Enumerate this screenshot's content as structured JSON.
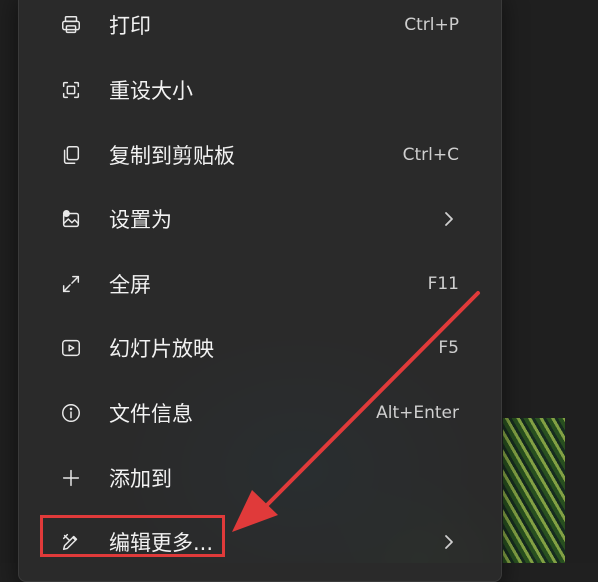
{
  "menu": {
    "items": [
      {
        "icon": "printer-icon",
        "label": "打印",
        "shortcut": "Ctrl+P",
        "submenu": false
      },
      {
        "icon": "resize-icon",
        "label": "重设大小",
        "shortcut": "",
        "submenu": false
      },
      {
        "icon": "copy-icon",
        "label": "复制到剪贴板",
        "shortcut": "Ctrl+C",
        "submenu": false
      },
      {
        "icon": "set-as-icon",
        "label": "设置为",
        "shortcut": "",
        "submenu": true
      },
      {
        "icon": "fullscreen-icon",
        "label": "全屏",
        "shortcut": "F11",
        "submenu": false
      },
      {
        "icon": "slideshow-icon",
        "label": "幻灯片放映",
        "shortcut": "F5",
        "submenu": false
      },
      {
        "icon": "info-icon",
        "label": "文件信息",
        "shortcut": "Alt+Enter",
        "submenu": false
      },
      {
        "icon": "plus-icon",
        "label": "添加到",
        "shortcut": "",
        "submenu": false
      },
      {
        "icon": "edit-icon",
        "label": "编辑更多...",
        "shortcut": "",
        "submenu": true
      }
    ]
  },
  "annotation": {
    "color": "#e03a3a",
    "target": "编辑更多..."
  }
}
